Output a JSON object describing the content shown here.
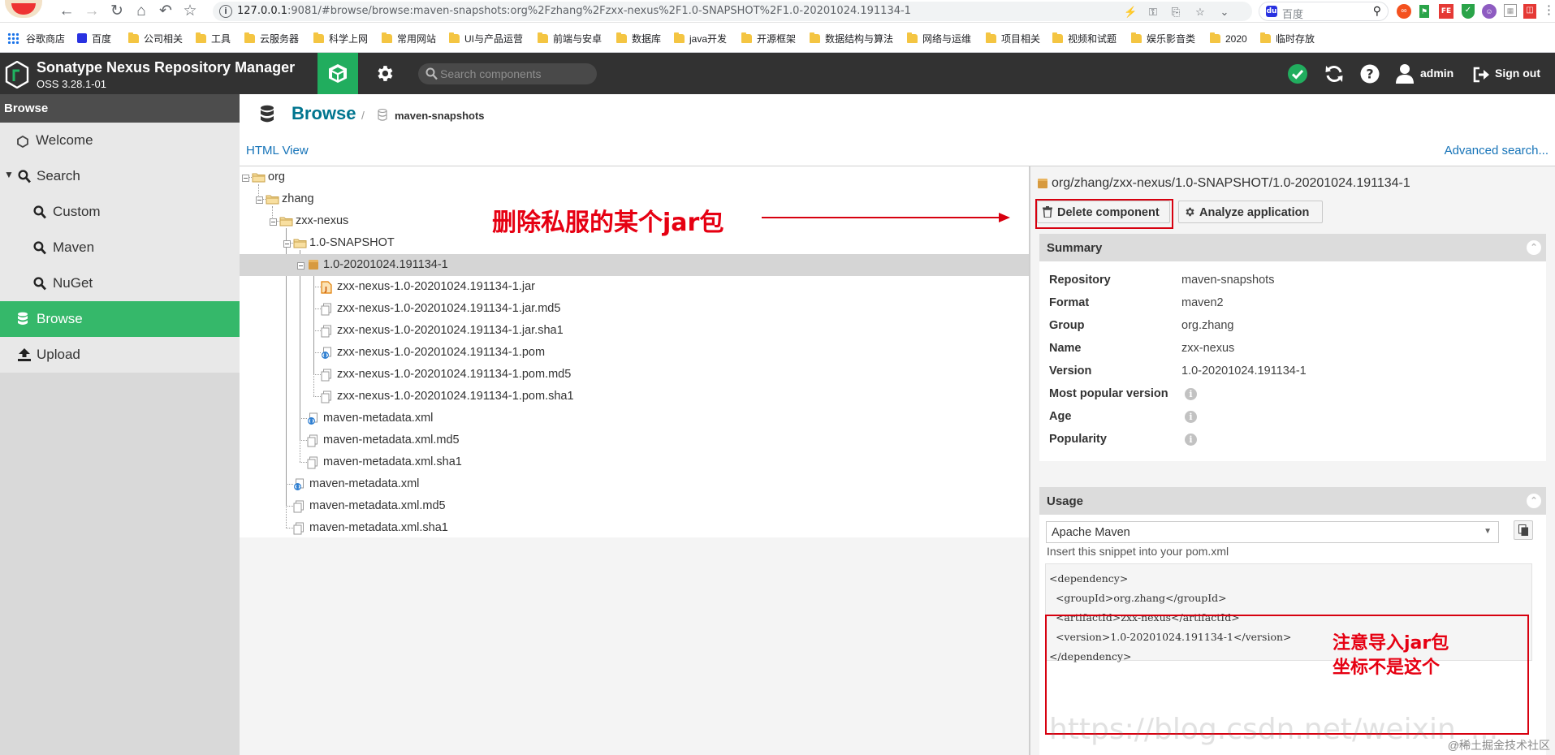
{
  "browser": {
    "url_host": "127.0.0.1",
    "url_rest": ":9081/#browse/browse:maven-snapshots:org%2Fzhang%2Fzxx-nexus%2F1.0-SNAPSHOT%2F1.0-20201024.191134-1",
    "search_engine_label": "百度"
  },
  "bookmarks": [
    "谷歌商店",
    "百度",
    "公司相关",
    "工具",
    "云服务器",
    "科学上网",
    "常用网站",
    "UI与产品运营",
    "前端与安卓",
    "数据库",
    "java开发",
    "开源框架",
    "数据结构与算法",
    "网络与运维",
    "项目相关",
    "视频和试题",
    "娱乐影音类",
    "2020",
    "临时存放"
  ],
  "header": {
    "app_title": "Sonatype Nexus Repository Manager",
    "version": "OSS 3.28.1-01",
    "search_placeholder": "Search components",
    "user": "admin",
    "sign_out": "Sign out"
  },
  "sidebar": {
    "title": "Browse",
    "items": [
      {
        "label": "Welcome"
      },
      {
        "label": "Search"
      },
      {
        "label": "Custom"
      },
      {
        "label": "Maven"
      },
      {
        "label": "NuGet"
      },
      {
        "label": "Browse"
      },
      {
        "label": "Upload"
      }
    ]
  },
  "main": {
    "crumb_title": "Browse",
    "crumb_repo": "maven-snapshots",
    "html_view": "HTML View",
    "advanced_search": "Advanced search...",
    "tree": [
      {
        "label": "org",
        "type": "folder"
      },
      {
        "label": "zhang",
        "type": "folder"
      },
      {
        "label": "zxx-nexus",
        "type": "folder"
      },
      {
        "label": "1.0-SNAPSHOT",
        "type": "folder"
      },
      {
        "label": "1.0-20201024.191134-1",
        "type": "component"
      },
      {
        "label": "zxx-nexus-1.0-20201024.191134-1.jar",
        "type": "jar"
      },
      {
        "label": "zxx-nexus-1.0-20201024.191134-1.jar.md5",
        "type": "file"
      },
      {
        "label": "zxx-nexus-1.0-20201024.191134-1.jar.sha1",
        "type": "file"
      },
      {
        "label": "zxx-nexus-1.0-20201024.191134-1.pom",
        "type": "xml"
      },
      {
        "label": "zxx-nexus-1.0-20201024.191134-1.pom.md5",
        "type": "file"
      },
      {
        "label": "zxx-nexus-1.0-20201024.191134-1.pom.sha1",
        "type": "file"
      },
      {
        "label": "maven-metadata.xml",
        "type": "xml"
      },
      {
        "label": "maven-metadata.xml.md5",
        "type": "file"
      },
      {
        "label": "maven-metadata.xml.sha1",
        "type": "file"
      },
      {
        "label": "maven-metadata.xml",
        "type": "xml"
      },
      {
        "label": "maven-metadata.xml.md5",
        "type": "file"
      },
      {
        "label": "maven-metadata.xml.sha1",
        "type": "file"
      }
    ]
  },
  "detail": {
    "path": "org/zhang/zxx-nexus/1.0-SNAPSHOT/1.0-20201024.191134-1",
    "delete_btn": "Delete component",
    "analyze_btn": "Analyze application",
    "summary_title": "Summary",
    "summary": [
      {
        "key": "Repository",
        "value": "maven-snapshots"
      },
      {
        "key": "Format",
        "value": "maven2"
      },
      {
        "key": "Group",
        "value": "org.zhang"
      },
      {
        "key": "Name",
        "value": "zxx-nexus"
      },
      {
        "key": "Version",
        "value": "1.0-20201024.191134-1"
      },
      {
        "key": "Most popular version",
        "value": ""
      },
      {
        "key": "Age",
        "value": ""
      },
      {
        "key": "Popularity",
        "value": ""
      }
    ],
    "usage_title": "Usage",
    "usage_select": "Apache Maven",
    "snippet_label": "Insert this snippet into your pom.xml",
    "snippet_lines": [
      "<dependency>",
      "  <groupId>org.zhang</groupId>",
      "  <artifactId>zxx-nexus</artifactId>",
      "  <version>1.0-20201024.191134-1</version>",
      "</dependency>"
    ]
  },
  "annotations": {
    "delete_note": "删除私服的某个jar包",
    "coord_note_1": "注意导入jar包",
    "coord_note_2": "坐标不是这个",
    "watermark": "https://blog.csdn.net/weixin_...",
    "corner": "@稀土掘金技术社区"
  },
  "colors": {
    "nexus_green": "#21ad5e",
    "header_dark": "#323232",
    "link_blue": "#1573b8",
    "annotation_red": "#d7000f"
  }
}
